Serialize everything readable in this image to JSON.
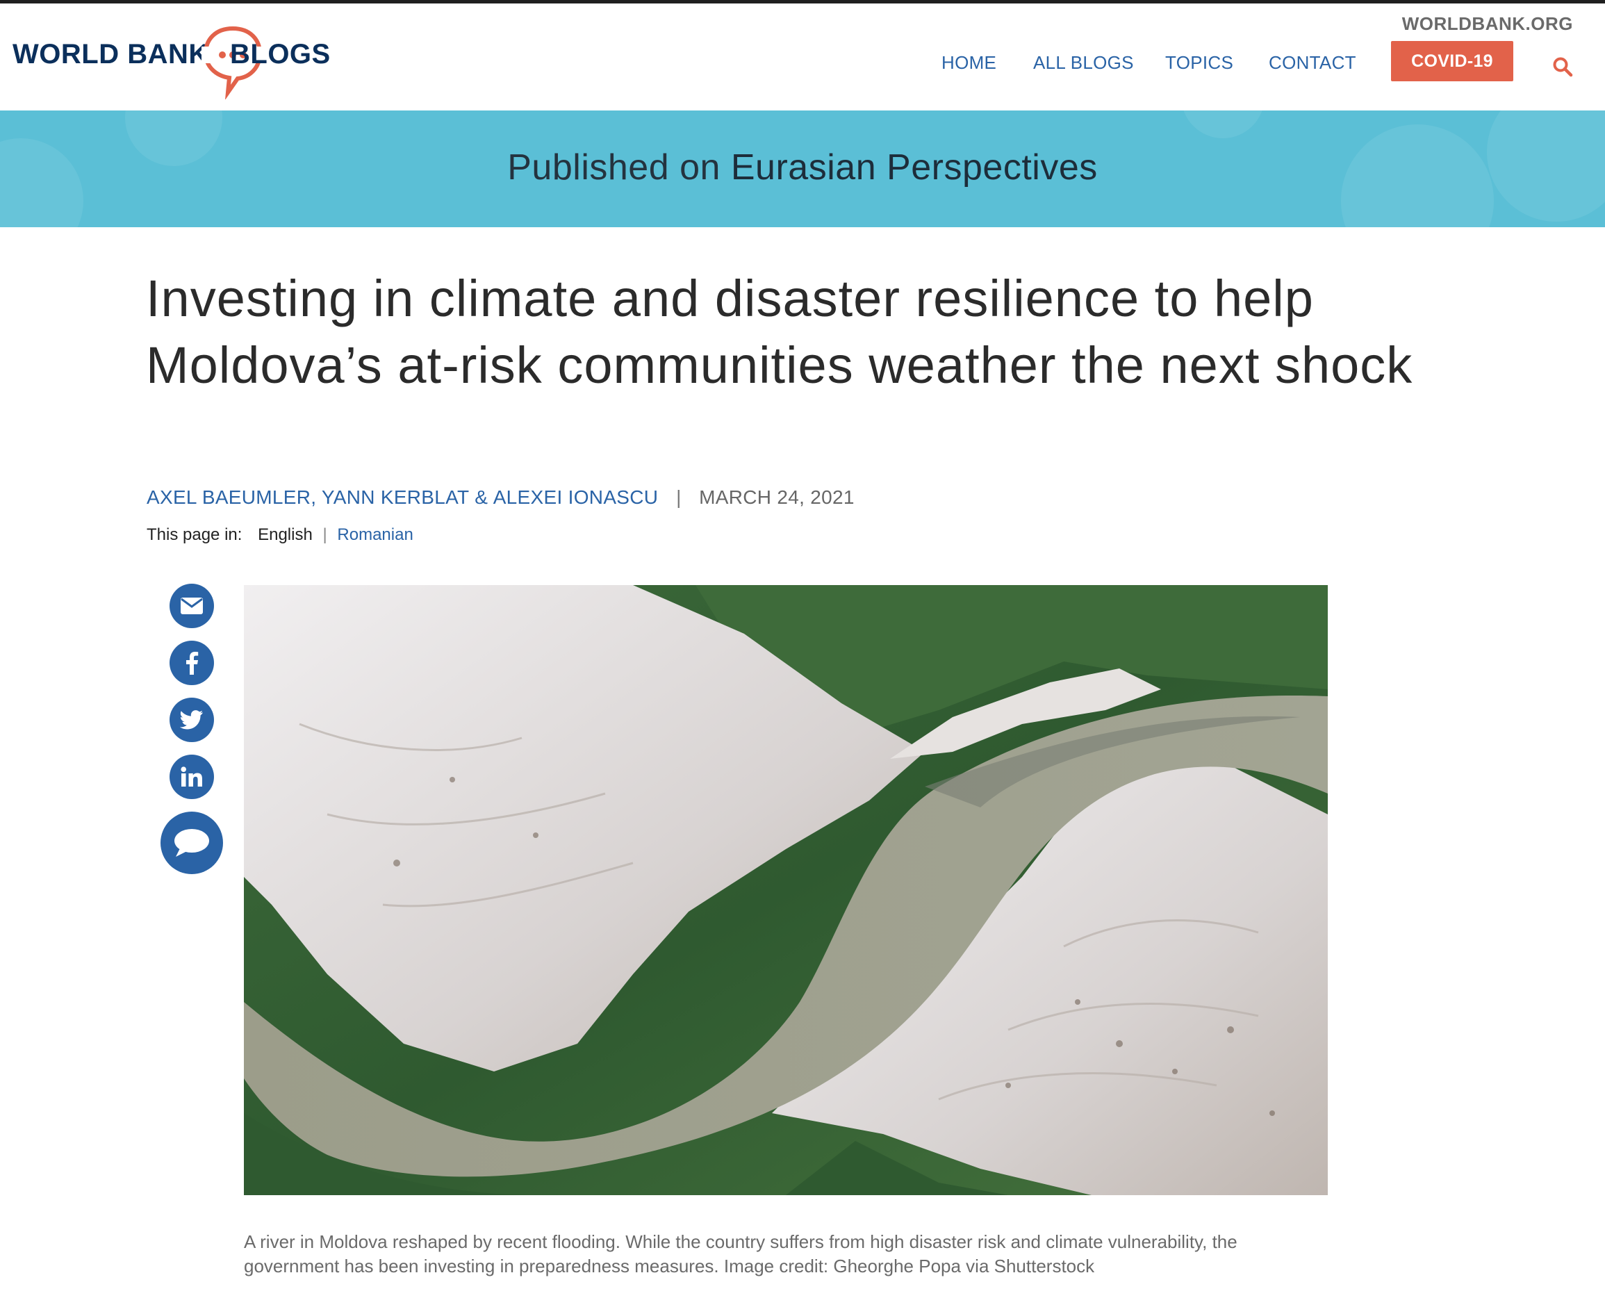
{
  "header": {
    "logo_left": "WORLD BANK",
    "logo_right": "BLOGS",
    "worldbank_link": "WORLDBANK.ORG",
    "nav": [
      {
        "label": "HOME"
      },
      {
        "label": "ALL BLOGS"
      },
      {
        "label": "TOPICS"
      },
      {
        "label": "CONTACT"
      }
    ],
    "covid_button": "COVID-19",
    "search_icon": "search-icon"
  },
  "banner": {
    "prefix": "Published on ",
    "blog_name": "Eurasian Perspectives"
  },
  "article": {
    "title": "Investing in climate and disaster resilience to help Moldova’s at-risk communities weather the next shock",
    "authors": [
      "AXEL BAEUMLER",
      "YANN KERBLAT",
      "ALEXEI IONASCU"
    ],
    "author_sep_1": ", ",
    "author_sep_2": " & ",
    "byline_sep": "|",
    "date": "MARCH 24, 2021",
    "language": {
      "label": "This page in:",
      "current": "English",
      "pipe": "|",
      "other": "Romanian"
    },
    "share": [
      "email-icon",
      "facebook-icon",
      "twitter-icon",
      "linkedin-icon",
      "comment-icon"
    ],
    "caption": "A river in Moldova reshaped by recent flooding. While the country suffers from high disaster risk and climate vulnerability, the government has been investing in preparedness measures. Image credit: Gheorghe Popa via Shutterstock"
  },
  "colors": {
    "brand_navy": "#0b2f5b",
    "link_blue": "#2a63a6",
    "covid_orange": "#e2624a",
    "banner_teal": "#5bbfd6"
  }
}
